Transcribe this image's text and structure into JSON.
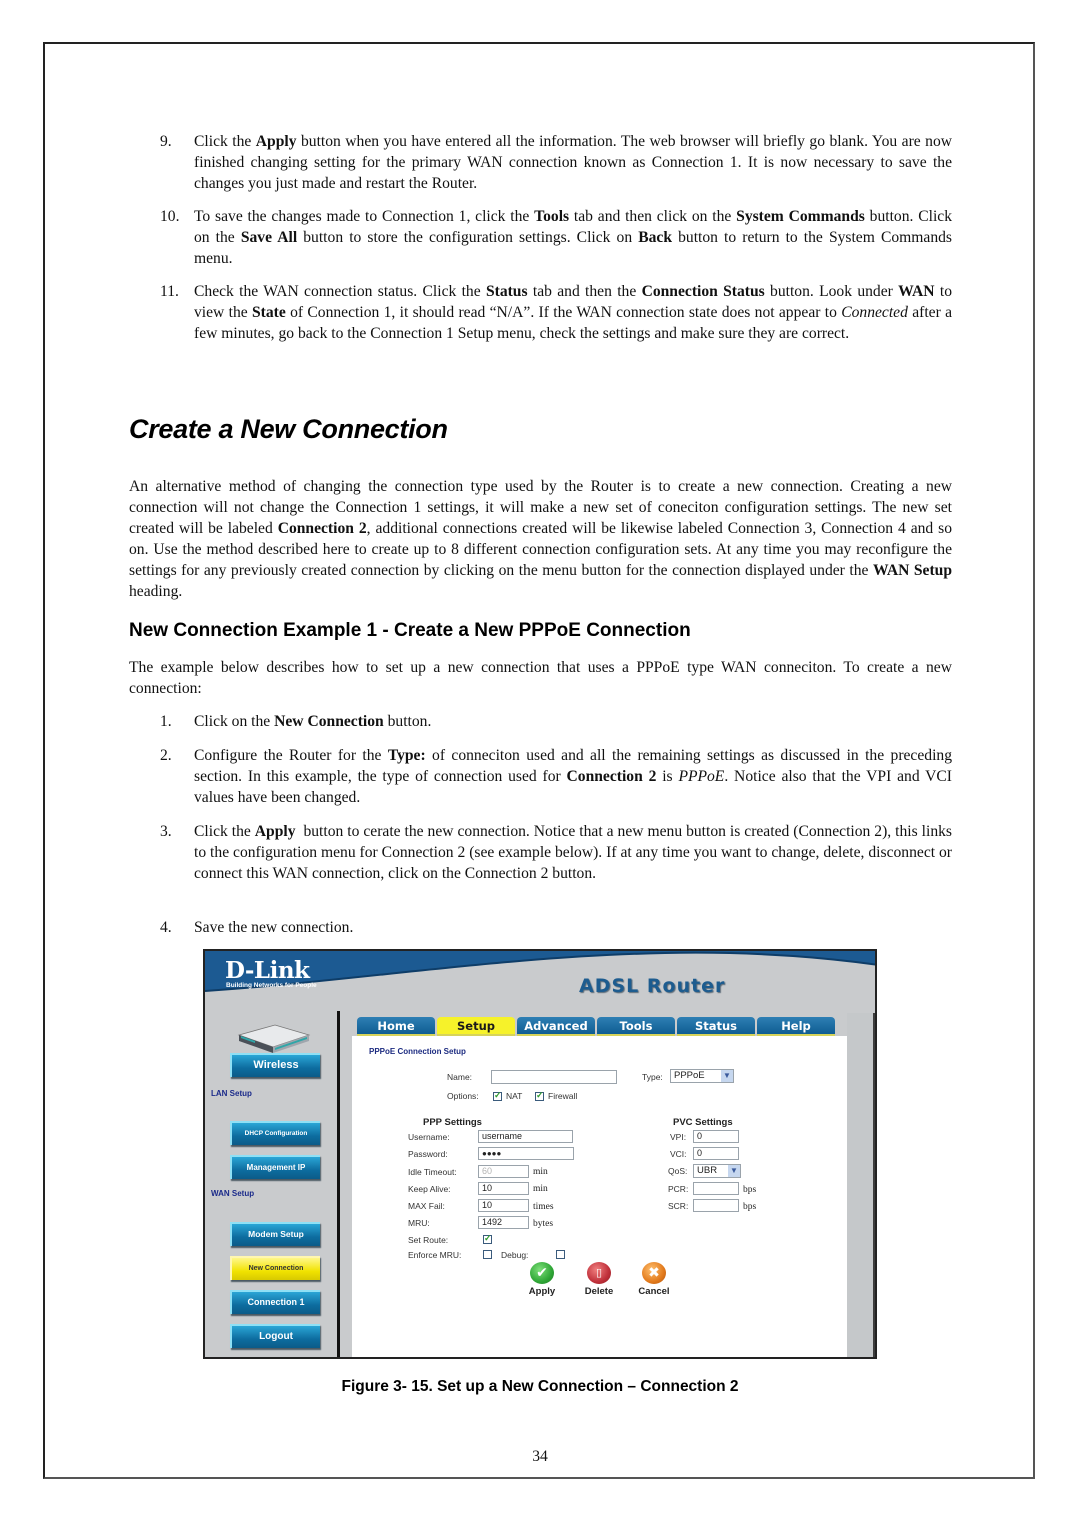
{
  "steps_top": [
    {
      "num": "9.",
      "html": "Click the <b>Apply</b> button when you have entered all the information. The web browser will briefly go blank. You are now finished changing setting for the primary WAN connection known as Connection 1. It is now necessary to save the changes you just made and restart the Router."
    },
    {
      "num": "10.",
      "html": "To save the changes made to Connection 1, click the <b>Tools</b> tab and then click on the <b>System Commands</b> button. Click on the <b>Save All</b> button to store the configuration settings. Click on <b>Back</b> button to return to the System Commands menu."
    },
    {
      "num": "11.",
      "html": "Check the WAN connection status. Click the <b>Status</b> tab and then the <b>Connection Status</b> button. Look under <b>WAN</b> to view the <b>State</b> of Connection 1, it should read “N/A”. If the WAN connection state does not appear to <i>Connected</i> after a few minutes, go back to the Connection 1 Setup menu, check the settings and make sure they are correct."
    }
  ],
  "section_title": "Create a New Connection",
  "intro_paragraph": "An alternative method of changing the connection type used by the Router is to create a new connection. Creating a new connection will not change the Connection 1 settings, it will make a new set of coneciton configuration settings. The new set created will be labeled <b>Connection 2</b>, additional connections created will be likewise labeled Connection 3, Connection 4 and so on. Use the method described here to create up to 8 different connection configuration sets. At any time you may reconfigure the settings for any previously created connection by clicking on the menu button for the connection displayed under the <b>WAN Setup</b> heading.",
  "subsection_title": "New Connection Example 1 - Create a New PPPoE Connection",
  "example_paragraph": "The example below describes how to set up a new connection that uses a PPPoE type WAN conneciton. To create a new connection:",
  "steps_example": [
    {
      "num": "1.",
      "html": "Click on the <b>New Connection</b> button."
    },
    {
      "num": "2.",
      "html": "Configure the Router for the <b>Type:</b> of conneciton used and all the remaining settings as discussed in the preceding section. In this example, the type of connection used for <b>Connection 2</b> is <i>PPPoE</i>. Notice also that the VPI and VCI values have been changed."
    },
    {
      "num": "3.",
      "html": "Click the <b>Apply</b>&nbsp; button to cerate the new connection. Notice that a new menu button is created (Connection 2), this links to the configuration menu for Connection 2 (see example below). If at any time you want to change, delete, disconnect or connect this WAN connection, click on the Connection 2 button."
    },
    {
      "num": "4.",
      "html": "Save the new connection."
    }
  ],
  "router": {
    "logo": "D-Link",
    "logo_tagline": "Building Networks for People",
    "product": "ADSL Router",
    "tabs": [
      {
        "label": "Home",
        "active": false
      },
      {
        "label": "Setup",
        "active": true
      },
      {
        "label": "Advanced",
        "active": false
      },
      {
        "label": "Tools",
        "active": false
      },
      {
        "label": "Status",
        "active": false
      },
      {
        "label": "Help",
        "active": false
      }
    ],
    "sidebar": {
      "wireless": "Wireless",
      "lan_heading": "LAN Setup",
      "dhcp": "DHCP Configuration",
      "mgmt_ip": "Management IP",
      "wan_heading": "WAN Setup",
      "modem": "Modem Setup",
      "new_connection": "New Connection",
      "connection1": "Connection 1",
      "logout": "Logout"
    },
    "form": {
      "title": "PPPoE Connection Setup",
      "name_label": "Name:",
      "name_value": "",
      "type_label": "Type:",
      "type_value": "PPPoE",
      "options_label": "Options:",
      "nat_label": "NAT",
      "nat_checked": true,
      "firewall_label": "Firewall",
      "firewall_checked": true,
      "ppp_heading": "PPP Settings",
      "username_label": "Username:",
      "username_value": "username",
      "password_label": "Password:",
      "password_value": "●●●●",
      "idle_label": "Idle Timeout:",
      "idle_value": "60",
      "idle_unit": "min",
      "keepalive_label": "Keep Alive:",
      "keepalive_value": "10",
      "keepalive_unit": "min",
      "maxfail_label": "MAX Fail:",
      "maxfail_value": "10",
      "maxfail_unit": "times",
      "mru_label": "MRU:",
      "mru_value": "1492",
      "mru_unit": "bytes",
      "setroute_label": "Set Route:",
      "setroute_checked": true,
      "enforce_label": "Enforce MRU:",
      "enforce_checked": false,
      "debug_label": "Debug:",
      "debug_checked": false,
      "pvc_heading": "PVC Settings",
      "vpi_label": "VPI:",
      "vpi_value": "0",
      "vci_label": "VCI:",
      "vci_value": "0",
      "qos_label": "QoS:",
      "qos_value": "UBR",
      "pcr_label": "PCR:",
      "pcr_value": "",
      "pcr_unit": "bps",
      "scr_label": "SCR:",
      "scr_value": "",
      "scr_unit": "bps"
    },
    "actions": {
      "apply": "Apply",
      "delete": "Delete",
      "cancel": "Cancel"
    },
    "colors": {
      "header_blue": "#1c5a92",
      "tab_blue": "#0f5d92",
      "active_yellow": "#f6f22a",
      "apply_green": "#2fa636",
      "delete_red": "#c0303a",
      "cancel_orange": "#e27a1c"
    }
  },
  "figure_caption": "Figure 3- 15. Set up a New Connection – Connection 2",
  "page_number": "34"
}
